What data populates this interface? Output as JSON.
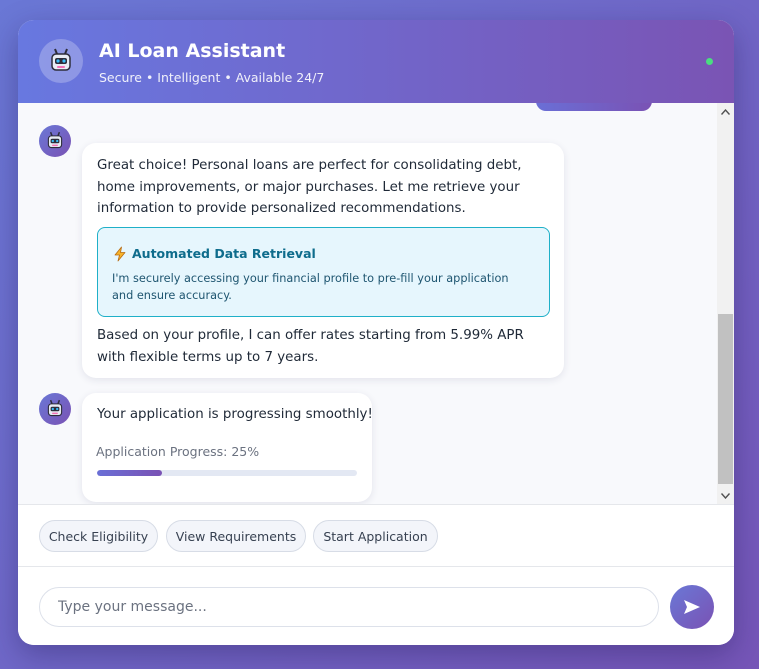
{
  "header": {
    "title": "AI Loan Assistant",
    "subtitle": "Secure • Intelligent • Available 24/7",
    "avatar_icon": "robot-icon",
    "status_color": "#4ade80"
  },
  "messages": [
    {
      "sender": "bot",
      "paragraph_1": "Great choice! Personal loans are perfect for consolidating debt, home improvements, or major purchases. Let me retrieve your information to provide personalized recommendations.",
      "info_box": {
        "icon": "lightning-icon",
        "title": "Automated Data Retrieval",
        "text": "I'm securely accessing your financial profile to pre-fill your application and ensure accuracy."
      },
      "paragraph_2": "Based on your profile, I can offer rates starting from 5.99% APR with flexible terms up to 7 years."
    },
    {
      "sender": "bot",
      "text": "Your application is progressing smoothly!",
      "progress_label": "Application Progress: 25%",
      "progress_percent": 25
    }
  ],
  "quick_actions": [
    "Check Eligibility",
    "View Requirements",
    "Start Application"
  ],
  "input": {
    "placeholder": "Type your message...",
    "value": ""
  },
  "send_icon": "send-icon",
  "colors": {
    "accent_start": "#6a78d6",
    "accent_end": "#7a52b4",
    "info_border": "#1fb0c8",
    "info_bg": "#e6f6fd"
  }
}
